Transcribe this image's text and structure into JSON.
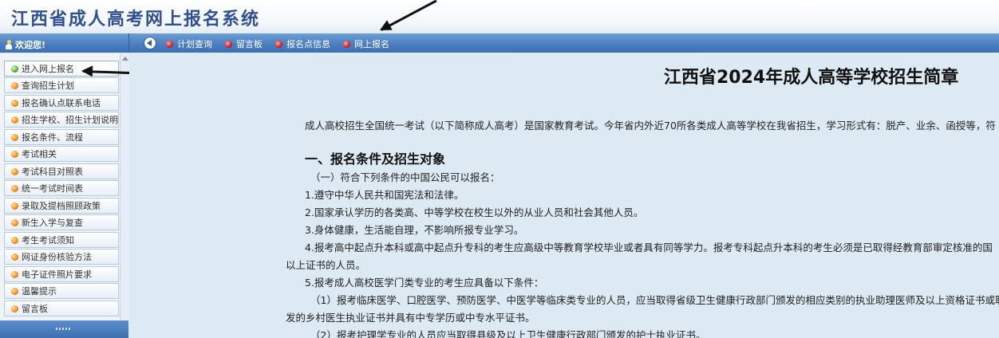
{
  "site_title": "江西省成人高考网上报名系统",
  "left_bar": {
    "welcome": "欢迎您!"
  },
  "top_nav": [
    {
      "label": "计划查询"
    },
    {
      "label": "留言板"
    },
    {
      "label": "报名点信息"
    },
    {
      "label": "网上报名"
    }
  ],
  "sidebar": {
    "items": [
      {
        "label": "进入网上报名",
        "bullet": "green"
      },
      {
        "label": "查询招生计划",
        "bullet": "orange"
      },
      {
        "label": "报名确认点联系电话",
        "bullet": "orange"
      },
      {
        "label": "招生学校、招生计划说明",
        "bullet": "orange"
      },
      {
        "label": "报名条件、流程",
        "bullet": "orange"
      },
      {
        "label": "考试相关",
        "bullet": "orange"
      },
      {
        "label": "考试科目对照表",
        "bullet": "orange"
      },
      {
        "label": "统一考试时间表",
        "bullet": "orange"
      },
      {
        "label": "录取及提档照顾政策",
        "bullet": "orange"
      },
      {
        "label": "新生入学与复查",
        "bullet": "orange"
      },
      {
        "label": "考生考试须知",
        "bullet": "orange"
      },
      {
        "label": "网证身份核验方法",
        "bullet": "orange"
      },
      {
        "label": "电子证件照片要求",
        "bullet": "orange"
      },
      {
        "label": "温馨提示",
        "bullet": "orange"
      },
      {
        "label": "留言板",
        "bullet": "orange"
      }
    ]
  },
  "main": {
    "title": "江西省2024年成人高等学校招生简章",
    "intro": "成人高校招生全国统一考试（以下简称成人高考）是国家教育考试。今年省内外近70所各类成人高等学校在我省招生，学习形式有：脱产、业余、函授等，符",
    "section1_title": "一、报名条件及招生对象",
    "lines": [
      "（一）符合下列条件的中国公民可以报名：",
      "1.遵守中华人民共和国宪法和法律。",
      "2.国家承认学历的各类高、中等学校在校生以外的从业人员和社会其他人员。",
      "3.身体健康，生活能自理，不影响所报专业学习。",
      "4.报考高中起点升本科或高中起点升专科的考生应高级中等教育学校毕业或者具有同等学力。报考专科起点升本科的考生必须是已取得经教育部审定核准的国",
      "以上证书的人员。",
      "5.报考成人高校医学门类专业的考生应具备以下条件：",
      "（1）报考临床医学、口腔医学、预防医学、中医学等临床类专业的人员，应当取得省级卫生健康行政部门颁发的相应类别的执业助理医师及以上资格证书或取",
      "发的乡村医生执业证书并具有中专学历或中专水平证书。",
      "（2）报考护理学专业的人员应当取得县级及以上卫生健康行政部门颁发的护士执业证书。"
    ]
  },
  "colors": {
    "nav_bar": "#4b7fc0",
    "page_bg": "#dde9f3",
    "title_blue": "#2f4f8f",
    "active_bullet": "#4caf2a",
    "bullet": "#f28a1c",
    "nav_dot": "#d91c1c"
  }
}
